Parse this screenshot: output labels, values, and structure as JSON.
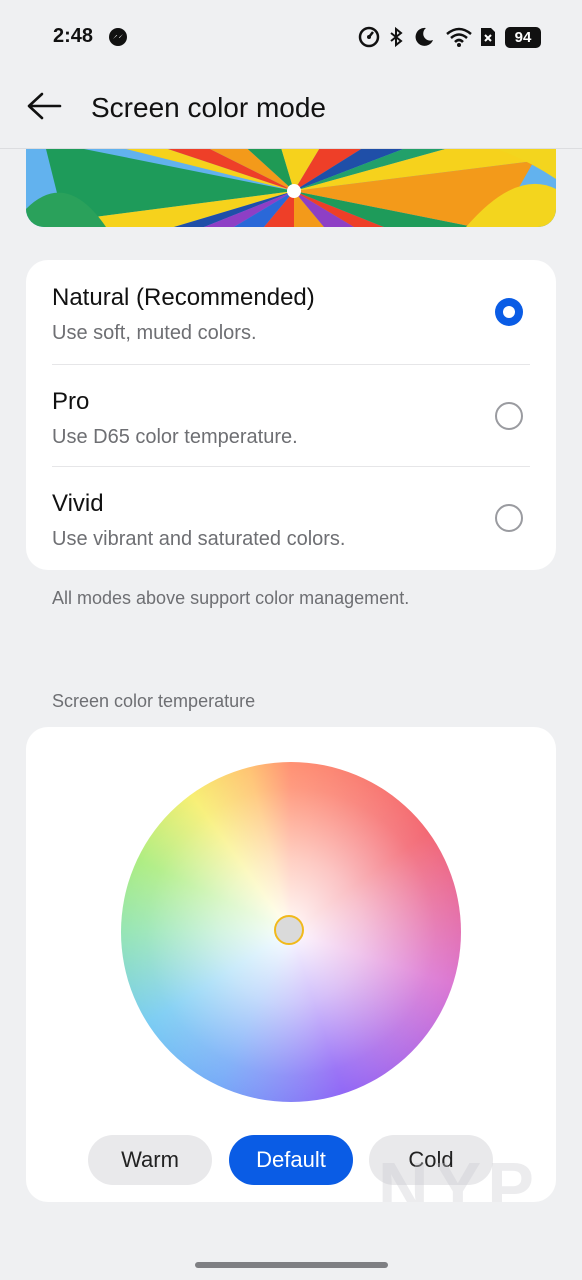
{
  "status_bar": {
    "time": "2:48",
    "battery": "94",
    "icons": [
      "messenger-icon",
      "data-saver-icon",
      "bluetooth-icon",
      "do-not-disturb-icon",
      "wifi-icon",
      "no-sim-icon",
      "battery-icon"
    ]
  },
  "header": {
    "back_icon": "arrow-left-icon",
    "title": "Screen color mode"
  },
  "modes": [
    {
      "title": "Natural (Recommended)",
      "description": "Use soft, muted colors.",
      "selected": true
    },
    {
      "title": "Pro",
      "description": "Use D65 color temperature.",
      "selected": false
    },
    {
      "title": "Vivid",
      "description": "Use vibrant and saturated colors.",
      "selected": false
    }
  ],
  "modes_note": "All modes above support color management.",
  "temperature": {
    "label": "Screen color temperature",
    "buttons": [
      {
        "label": "Warm",
        "selected": false
      },
      {
        "label": "Default",
        "selected": true
      },
      {
        "label": "Cold",
        "selected": false
      }
    ]
  },
  "watermark": "NYP",
  "colors": {
    "accent": "#0a5ce5",
    "background": "#eff0f2",
    "card": "#ffffff",
    "secondary_text": "#6e6f73"
  }
}
